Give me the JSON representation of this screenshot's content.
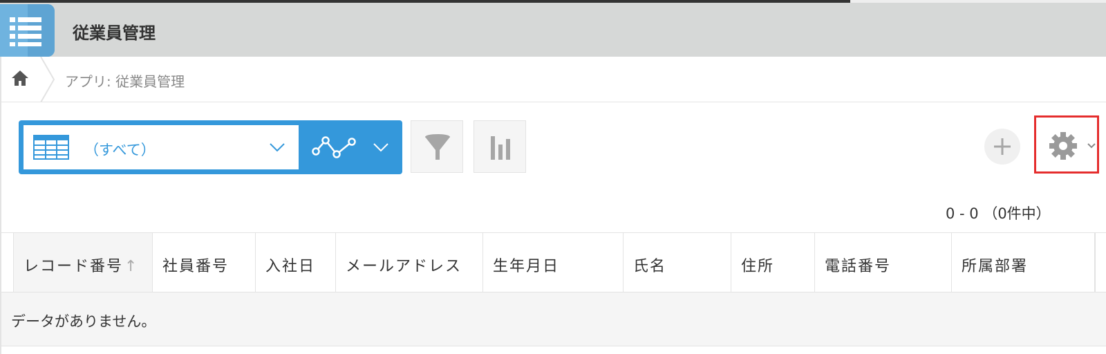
{
  "header": {
    "app_title": "従業員管理",
    "app_icon": "list-icon",
    "app_icon_color": "#6fb3df"
  },
  "breadcrumb": {
    "home_icon": "home-icon",
    "current": "アプリ: 従業員管理"
  },
  "toolbar": {
    "view_icon": "table-view-icon",
    "view_label": "（すべて）",
    "graph_icon": "graph-line-icon",
    "filter_icon": "filter-icon",
    "chart_icon": "bar-chart-icon",
    "add_icon": "plus-icon",
    "settings_icon": "gear-icon",
    "accent_color": "#3498db",
    "highlight_color": "#e52d2d"
  },
  "pagination": {
    "text": "0 - 0 （0件中）"
  },
  "table": {
    "columns": [
      {
        "label": "レコード番号",
        "sorted": true
      },
      {
        "label": "社員番号"
      },
      {
        "label": "入社日"
      },
      {
        "label": "メールアドレス"
      },
      {
        "label": "生年月日"
      },
      {
        "label": "氏名"
      },
      {
        "label": "住所"
      },
      {
        "label": "電話番号"
      },
      {
        "label": "所属部署"
      }
    ],
    "sort_indicator": "↑",
    "empty_message": "データがありません。"
  }
}
